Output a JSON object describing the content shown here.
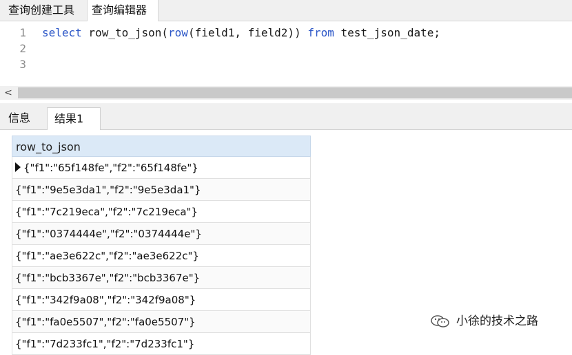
{
  "top_tabs": [
    {
      "label": "查询创建工具"
    },
    {
      "label": "查询编辑器"
    }
  ],
  "editor": {
    "lines": [
      {
        "num": "1",
        "tokens": [
          {
            "t": "select",
            "kw": true
          },
          {
            "t": " row_to_json(",
            "kw": false
          },
          {
            "t": "row",
            "kw": true
          },
          {
            "t": "(field1, field2)) ",
            "kw": false
          },
          {
            "t": "from",
            "kw": true
          },
          {
            "t": " test_json_date;",
            "kw": false
          }
        ]
      },
      {
        "num": "2",
        "tokens": []
      },
      {
        "num": "3",
        "tokens": []
      }
    ]
  },
  "scrollbar": {
    "left_arrow": "<"
  },
  "result_tabs": [
    {
      "label": "信息"
    },
    {
      "label": "结果1"
    }
  ],
  "grid": {
    "column": "row_to_json",
    "rows": [
      "{\"f1\":\"65f148fe\",\"f2\":\"65f148fe\"}",
      "{\"f1\":\"9e5e3da1\",\"f2\":\"9e5e3da1\"}",
      "{\"f1\":\"7c219eca\",\"f2\":\"7c219eca\"}",
      "{\"f1\":\"0374444e\",\"f2\":\"0374444e\"}",
      "{\"f1\":\"ae3e622c\",\"f2\":\"ae3e622c\"}",
      "{\"f1\":\"bcb3367e\",\"f2\":\"bcb3367e\"}",
      "{\"f1\":\"342f9a08\",\"f2\":\"342f9a08\"}",
      "{\"f1\":\"fa0e5507\",\"f2\":\"fa0e5507\"}",
      "{\"f1\":\"7d233fc1\",\"f2\":\"7d233fc1\"}"
    ],
    "selected_row": 0
  },
  "watermark": {
    "text": "小徐的技术之路",
    "icon": "wechat-icon"
  },
  "colors": {
    "keyword": "#2b56c7",
    "header_bg": "#dbe9f7"
  }
}
